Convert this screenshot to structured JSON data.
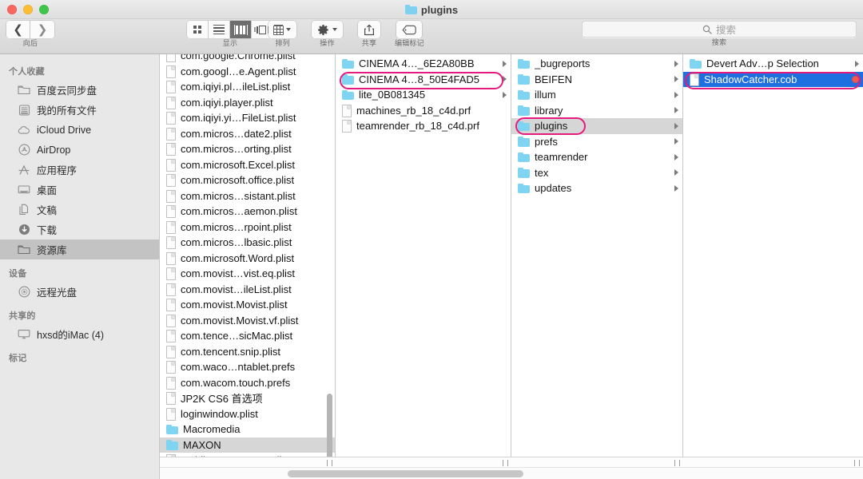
{
  "window": {
    "title": "plugins",
    "traffic_lights": [
      "close",
      "minimize",
      "zoom"
    ]
  },
  "toolbar": {
    "nav_caption": "向后",
    "view_caption": "显示",
    "arrange_caption": "排列",
    "action_caption": "操作",
    "share_caption": "共享",
    "tags_caption": "编辑标记",
    "search_caption": "搜索",
    "search_placeholder": "搜索",
    "view_modes": [
      "icon-view",
      "list-view",
      "column-view",
      "coverflow-view"
    ],
    "active_view": "column-view"
  },
  "sidebar": {
    "sections": [
      {
        "header": "个人收藏",
        "items": [
          {
            "label": "百度云同步盘",
            "icon": "folder-icon",
            "selected": false
          },
          {
            "label": "我的所有文件",
            "icon": "all-files-icon",
            "selected": false
          },
          {
            "label": "iCloud Drive",
            "icon": "cloud-icon",
            "selected": false
          },
          {
            "label": "AirDrop",
            "icon": "airdrop-icon",
            "selected": false
          },
          {
            "label": "应用程序",
            "icon": "applications-icon",
            "selected": false
          },
          {
            "label": "桌面",
            "icon": "desktop-icon",
            "selected": false
          },
          {
            "label": "文稿",
            "icon": "documents-icon",
            "selected": false
          },
          {
            "label": "下载",
            "icon": "downloads-icon",
            "selected": false
          },
          {
            "label": "资源库",
            "icon": "folder-icon",
            "selected": true
          }
        ]
      },
      {
        "header": "设备",
        "items": [
          {
            "label": "远程光盘",
            "icon": "optical-disc-icon",
            "selected": false
          }
        ]
      },
      {
        "header": "共享的",
        "items": [
          {
            "label": "hxsd的iMac (4)",
            "icon": "imac-icon",
            "selected": false
          }
        ]
      },
      {
        "header": "标记",
        "items": []
      }
    ]
  },
  "columns": [
    {
      "name": "library-column",
      "items": [
        {
          "label": "com.google.Chrome.plist",
          "type": "file",
          "state": "none",
          "clipped_top": true
        },
        {
          "label": "com.googl…e.Agent.plist",
          "type": "file",
          "state": "none"
        },
        {
          "label": "com.iqiyi.pl…ileList.plist",
          "type": "file",
          "state": "none"
        },
        {
          "label": "com.iqiyi.player.plist",
          "type": "file",
          "state": "none"
        },
        {
          "label": "com.iqiyi.yi…FileList.plist",
          "type": "file",
          "state": "none"
        },
        {
          "label": "com.micros…date2.plist",
          "type": "file",
          "state": "none"
        },
        {
          "label": "com.micros…orting.plist",
          "type": "file",
          "state": "none"
        },
        {
          "label": "com.microsoft.Excel.plist",
          "type": "file",
          "state": "none"
        },
        {
          "label": "com.microsoft.office.plist",
          "type": "file",
          "state": "none"
        },
        {
          "label": "com.micros…sistant.plist",
          "type": "file",
          "state": "none"
        },
        {
          "label": "com.micros…aemon.plist",
          "type": "file",
          "state": "none"
        },
        {
          "label": "com.micros…rpoint.plist",
          "type": "file",
          "state": "none"
        },
        {
          "label": "com.micros…lbasic.plist",
          "type": "file",
          "state": "none"
        },
        {
          "label": "com.microsoft.Word.plist",
          "type": "file",
          "state": "none"
        },
        {
          "label": "com.movist…vist.eq.plist",
          "type": "file",
          "state": "none"
        },
        {
          "label": "com.movist…ileList.plist",
          "type": "file",
          "state": "none"
        },
        {
          "label": "com.movist.Movist.plist",
          "type": "file",
          "state": "none"
        },
        {
          "label": "com.movist.Movist.vf.plist",
          "type": "file",
          "state": "none"
        },
        {
          "label": "com.tence…sicMac.plist",
          "type": "file",
          "state": "none"
        },
        {
          "label": "com.tencent.snip.plist",
          "type": "file",
          "state": "none"
        },
        {
          "label": "com.waco…ntablet.prefs",
          "type": "file",
          "state": "none"
        },
        {
          "label": "com.wacom.touch.prefs",
          "type": "file",
          "state": "none"
        },
        {
          "label": "JP2K CS6 首选项",
          "type": "file",
          "state": "none"
        },
        {
          "label": "loginwindow.plist",
          "type": "file",
          "state": "none"
        },
        {
          "label": "Macromedia",
          "type": "folder",
          "state": "none",
          "disclosure": true
        },
        {
          "label": "MAXON",
          "type": "folder",
          "state": "selected-inactive",
          "disclosure": true
        },
        {
          "label": "MobileMeAccounts.plist",
          "type": "file",
          "state": "none"
        }
      ]
    },
    {
      "name": "maxon-column",
      "items": [
        {
          "label": "CINEMA 4…_6E2A80BB",
          "type": "folder",
          "state": "none",
          "disclosure": true
        },
        {
          "label": "CINEMA 4…8_50E4FAD5",
          "type": "folder",
          "state": "none",
          "disclosure": true,
          "highlight": true
        },
        {
          "label": "lite_0B081345",
          "type": "folder",
          "state": "none",
          "disclosure": true
        },
        {
          "label": "machines_rb_18_c4d.prf",
          "type": "file",
          "state": "none"
        },
        {
          "label": "teamrender_rb_18_c4d.prf",
          "type": "file",
          "state": "none"
        }
      ]
    },
    {
      "name": "cinema4d-column",
      "items": [
        {
          "label": "_bugreports",
          "type": "folder",
          "state": "none",
          "disclosure": true
        },
        {
          "label": "BEIFEN",
          "type": "folder",
          "state": "none",
          "disclosure": true
        },
        {
          "label": "illum",
          "type": "folder",
          "state": "none",
          "disclosure": true
        },
        {
          "label": "library",
          "type": "folder",
          "state": "none",
          "disclosure": true
        },
        {
          "label": "plugins",
          "type": "folder",
          "state": "selected-inactive",
          "disclosure": true,
          "highlight": true
        },
        {
          "label": "prefs",
          "type": "folder",
          "state": "none",
          "disclosure": true
        },
        {
          "label": "teamrender",
          "type": "folder",
          "state": "none",
          "disclosure": true
        },
        {
          "label": "tex",
          "type": "folder",
          "state": "none",
          "disclosure": true
        },
        {
          "label": "updates",
          "type": "folder",
          "state": "none",
          "disclosure": true
        }
      ]
    },
    {
      "name": "plugins-column",
      "items": [
        {
          "label": "Devert Adv…p Selection",
          "type": "folder",
          "state": "none",
          "disclosure": true
        },
        {
          "label": "ShadowCatcher.cob",
          "type": "file",
          "state": "selected-active",
          "highlight": true,
          "tag": "red"
        }
      ]
    }
  ],
  "colors": {
    "highlight_box": "#e6197f",
    "selection_blue": "#1e6fe0",
    "selection_gray": "#d6d6d6",
    "folder_blue": "#7fd4f2",
    "red_tag": "#f3584f"
  }
}
